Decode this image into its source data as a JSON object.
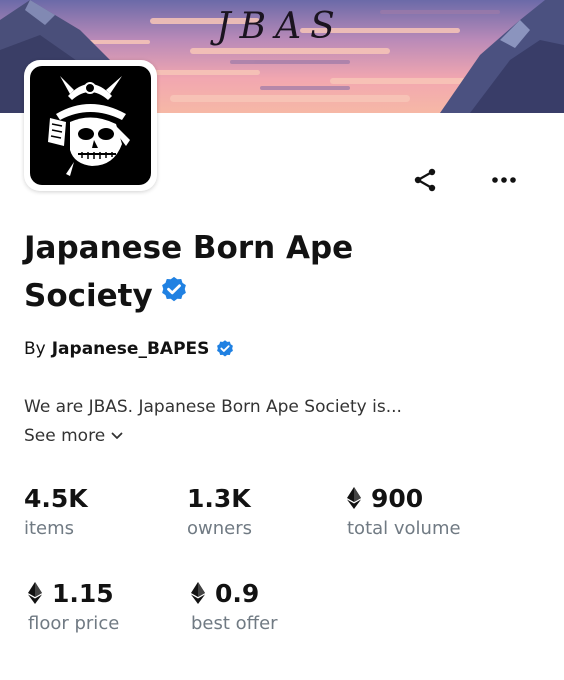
{
  "banner": {
    "title": "JBAS"
  },
  "collection": {
    "name": "Japanese Born Ape Society",
    "creator_prefix": "By",
    "creator_name": "Japanese_BAPES",
    "description": "We are JBAS. Japanese Born Ape Society is...",
    "see_more_label": "See more"
  },
  "stats": [
    {
      "value": "4.5K",
      "label": "items",
      "eth": false
    },
    {
      "value": "1.3K",
      "label": "owners",
      "eth": false
    },
    {
      "value": "900",
      "label": "total volume",
      "eth": true
    },
    {
      "value": "1.15",
      "label": "floor price",
      "eth": true
    },
    {
      "value": "0.9",
      "label": "best offer",
      "eth": true
    }
  ],
  "icons": {
    "verified": "verified-badge-icon",
    "share": "share-icon",
    "more": "more-horizontal-icon",
    "chevron": "chevron-down-icon",
    "eth": "ethereum-icon"
  },
  "colors": {
    "verified": "#2081e2",
    "muted": "#707a83",
    "text": "#121212"
  }
}
